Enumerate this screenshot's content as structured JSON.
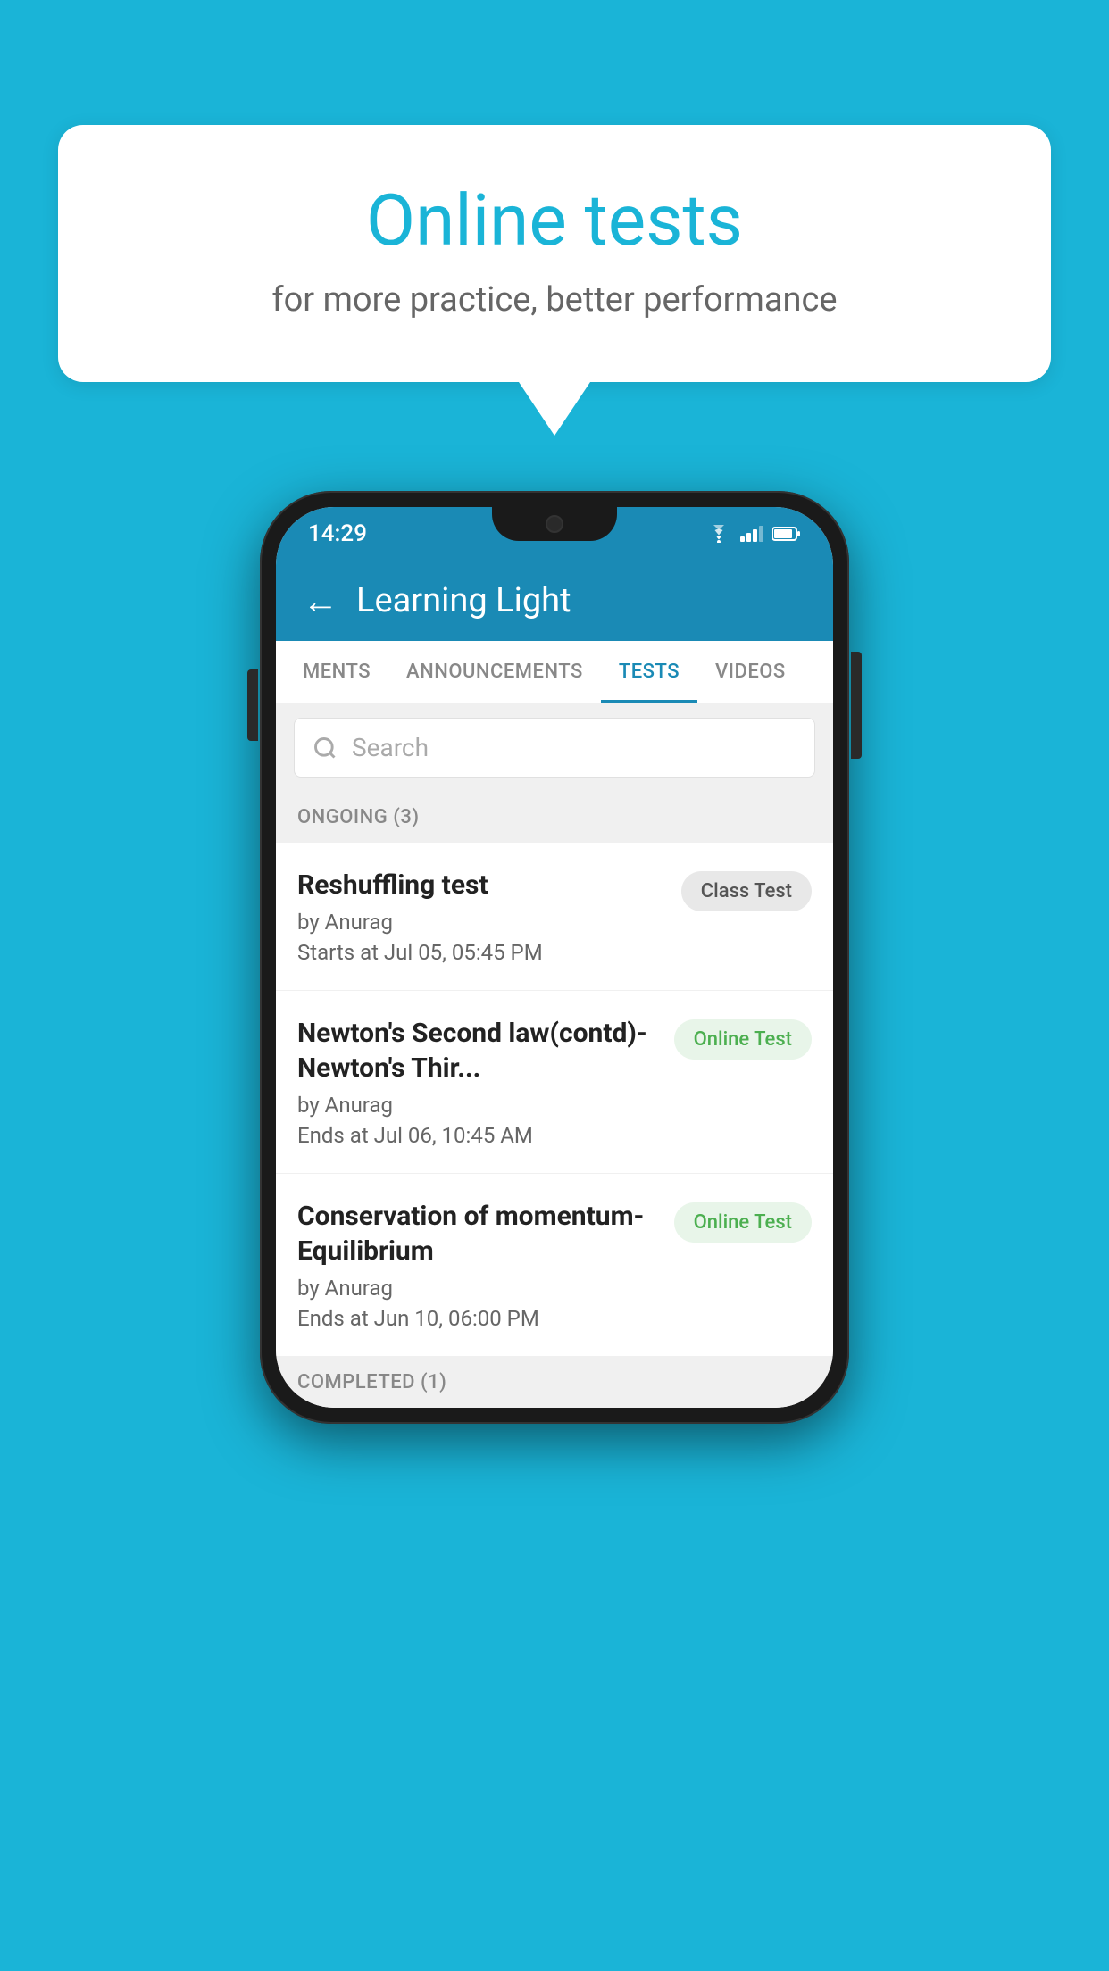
{
  "background": {
    "color": "#1ab4d7"
  },
  "speech_bubble": {
    "title": "Online tests",
    "subtitle": "for more practice, better performance"
  },
  "phone": {
    "status_bar": {
      "time": "14:29",
      "icons": [
        "wifi",
        "signal",
        "battery"
      ]
    },
    "header": {
      "back_label": "←",
      "title": "Learning Light"
    },
    "tabs": [
      {
        "label": "MENTS",
        "active": false
      },
      {
        "label": "ANNOUNCEMENTS",
        "active": false
      },
      {
        "label": "TESTS",
        "active": true
      },
      {
        "label": "VIDEOS",
        "active": false
      }
    ],
    "search": {
      "placeholder": "Search"
    },
    "ongoing_section": {
      "label": "ONGOING (3)"
    },
    "tests": [
      {
        "title": "Reshuffling test",
        "author": "by Anurag",
        "date": "Starts at  Jul 05, 05:45 PM",
        "badge": "Class Test",
        "badge_type": "class"
      },
      {
        "title": "Newton's Second law(contd)-Newton's Thir...",
        "author": "by Anurag",
        "date": "Ends at  Jul 06, 10:45 AM",
        "badge": "Online Test",
        "badge_type": "online"
      },
      {
        "title": "Conservation of momentum-Equilibrium",
        "author": "by Anurag",
        "date": "Ends at  Jun 10, 06:00 PM",
        "badge": "Online Test",
        "badge_type": "online"
      }
    ],
    "completed_section": {
      "label": "COMPLETED (1)"
    }
  }
}
